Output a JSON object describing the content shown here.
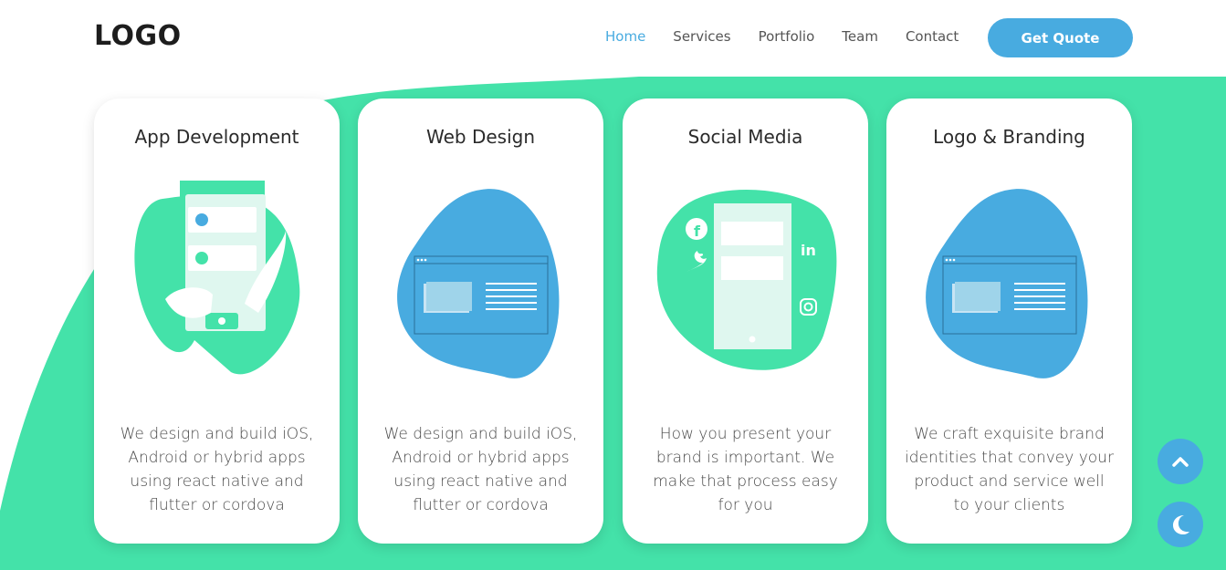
{
  "header": {
    "logo": "LOGO",
    "nav": [
      {
        "label": "Home",
        "active": true
      },
      {
        "label": "Services",
        "active": false
      },
      {
        "label": "Portfolio",
        "active": false
      },
      {
        "label": "Team",
        "active": false
      },
      {
        "label": "Contact",
        "active": false
      }
    ],
    "cta_label": "Get Quote"
  },
  "services": [
    {
      "title": "App Development",
      "description": "We design and build iOS, Android or hybrid apps using react native and flutter or cordova",
      "illustration": "phone-hand-illustration"
    },
    {
      "title": "Web Design",
      "description": "We design and build iOS, Android or hybrid apps using react native and flutter or cordova",
      "illustration": "browser-window-illustration"
    },
    {
      "title": "Social Media",
      "description": "How you present your brand is important. We make that process easy for you",
      "illustration": "social-phone-illustration"
    },
    {
      "title": "Logo & Branding",
      "description": "We craft exquisite brand identities that convey your product and service well to your clients",
      "illustration": "browser-window-illustration"
    }
  ],
  "floating": {
    "scroll_top_icon": "chevron-up-icon",
    "dark_mode_icon": "moon-icon"
  },
  "colors": {
    "accent_blue": "#48abe0",
    "accent_green": "#44e2a9",
    "light_green": "#dff7ef"
  }
}
